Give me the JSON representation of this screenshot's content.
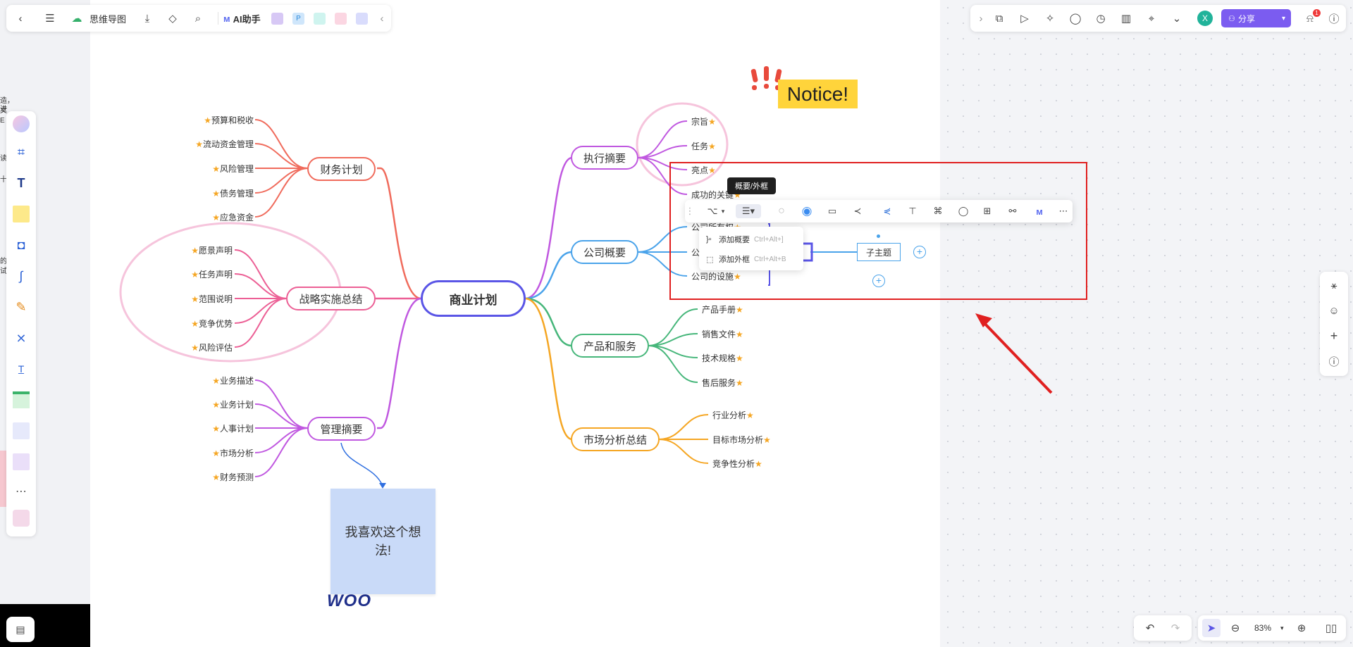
{
  "header": {
    "doc_title": "思维导图",
    "ai_label": "AI助手",
    "share_label": "分享",
    "avatar_letter": "X",
    "notification_count": "1"
  },
  "side_text_fragments": [
    "造，进",
    "文",
    "E",
    "读",
    "十",
    "的",
    "试"
  ],
  "mindmap": {
    "root": "商业计划",
    "branches": [
      {
        "label": "财务计划",
        "color": "#f06b5c",
        "children": [
          "预算和税收",
          "流动资金管理",
          "风险管理",
          "债务管理",
          "应急资金"
        ]
      },
      {
        "label": "战略实施总结",
        "color": "#ec5f95",
        "children": [
          "愿景声明",
          "任务声明",
          "范围说明",
          "竞争优势",
          "风险评估"
        ]
      },
      {
        "label": "管理摘要",
        "color": "#c058e0",
        "children": [
          "业务描述",
          "业务计划",
          "人事计划",
          "市场分析",
          "财务预测"
        ]
      },
      {
        "label": "执行摘要",
        "color": "#c058e0",
        "children": [
          "宗旨",
          "任务",
          "亮点",
          "成功的关键"
        ]
      },
      {
        "label": "公司概要",
        "color": "#4aa3ea",
        "children": [
          "公司所有权",
          "公司历史",
          "公司的设施"
        ]
      },
      {
        "label": "产品和服务",
        "color": "#46b67a",
        "children": [
          "产品手册",
          "销售文件",
          "技术规格",
          "售后服务"
        ]
      },
      {
        "label": "市场分析总结",
        "color": "#f5a623",
        "children": [
          "行业分析",
          "目标市场分析",
          "竞争性分析"
        ]
      }
    ],
    "new_subtopic": "子主题",
    "star": "★"
  },
  "notice_text": "Notice!",
  "sticky_note": "我喜欢这个想法!",
  "woo_sticker": "WOO",
  "floating_toolbar": {
    "tooltip": "概要/外框",
    "menu": [
      {
        "label": "添加概要",
        "shortcut": "Ctrl+Alt+]"
      },
      {
        "label": "添加外框",
        "shortcut": "Ctrl+Alt+B"
      }
    ]
  },
  "zoom": {
    "level": "83%"
  },
  "colors": {
    "accent": "#6c5ce7",
    "highlight": "#e02020",
    "notice": "#ffd43b",
    "sticky": "#c9daf8"
  }
}
